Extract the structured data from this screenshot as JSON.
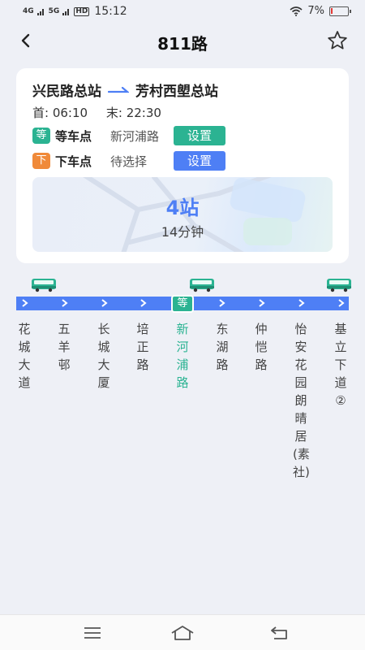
{
  "status_bar": {
    "network_1": "4G",
    "network_2": "5G",
    "hd": "HD",
    "time": "15:12",
    "battery": "7%",
    "battery_level": 0.07,
    "battery_color": "#e53935"
  },
  "header": {
    "title": "811路",
    "back_icon": "chevron-left-icon",
    "favorite_icon": "star-outline-icon"
  },
  "route": {
    "from": "兴民路总站",
    "to": "芳村西塱总站",
    "first_label": "首:",
    "first_time": "06:10",
    "last_label": "末:",
    "last_time": "22:30"
  },
  "wait_point": {
    "badge": "等",
    "label": "等车点",
    "value": "新河浦路",
    "button": "设置",
    "color": "#2bb392"
  },
  "alight_point": {
    "badge": "下",
    "label": "下车点",
    "value": "待选择",
    "button": "设置",
    "badge_color": "#f08a3a",
    "button_color": "#4e7ff5"
  },
  "arrival": {
    "stops": "4站",
    "minutes": "14分钟"
  },
  "line": {
    "wait_marker": "等",
    "accent": "#4e7ff5",
    "bus_icon": "bus-icon",
    "stops": [
      {
        "name": "花城大道"
      },
      {
        "name": "五羊邨"
      },
      {
        "name": "长城大厦"
      },
      {
        "name": "培正路"
      },
      {
        "name": "新河浦路",
        "current": true
      },
      {
        "name": "东湖路"
      },
      {
        "name": "仲恺路"
      },
      {
        "name": "怡安花园朗晴居(素社)"
      },
      {
        "name": "基立下道②"
      }
    ]
  },
  "bottom_nav": {
    "icons": [
      "menu-icon",
      "home-icon",
      "return-icon"
    ]
  }
}
